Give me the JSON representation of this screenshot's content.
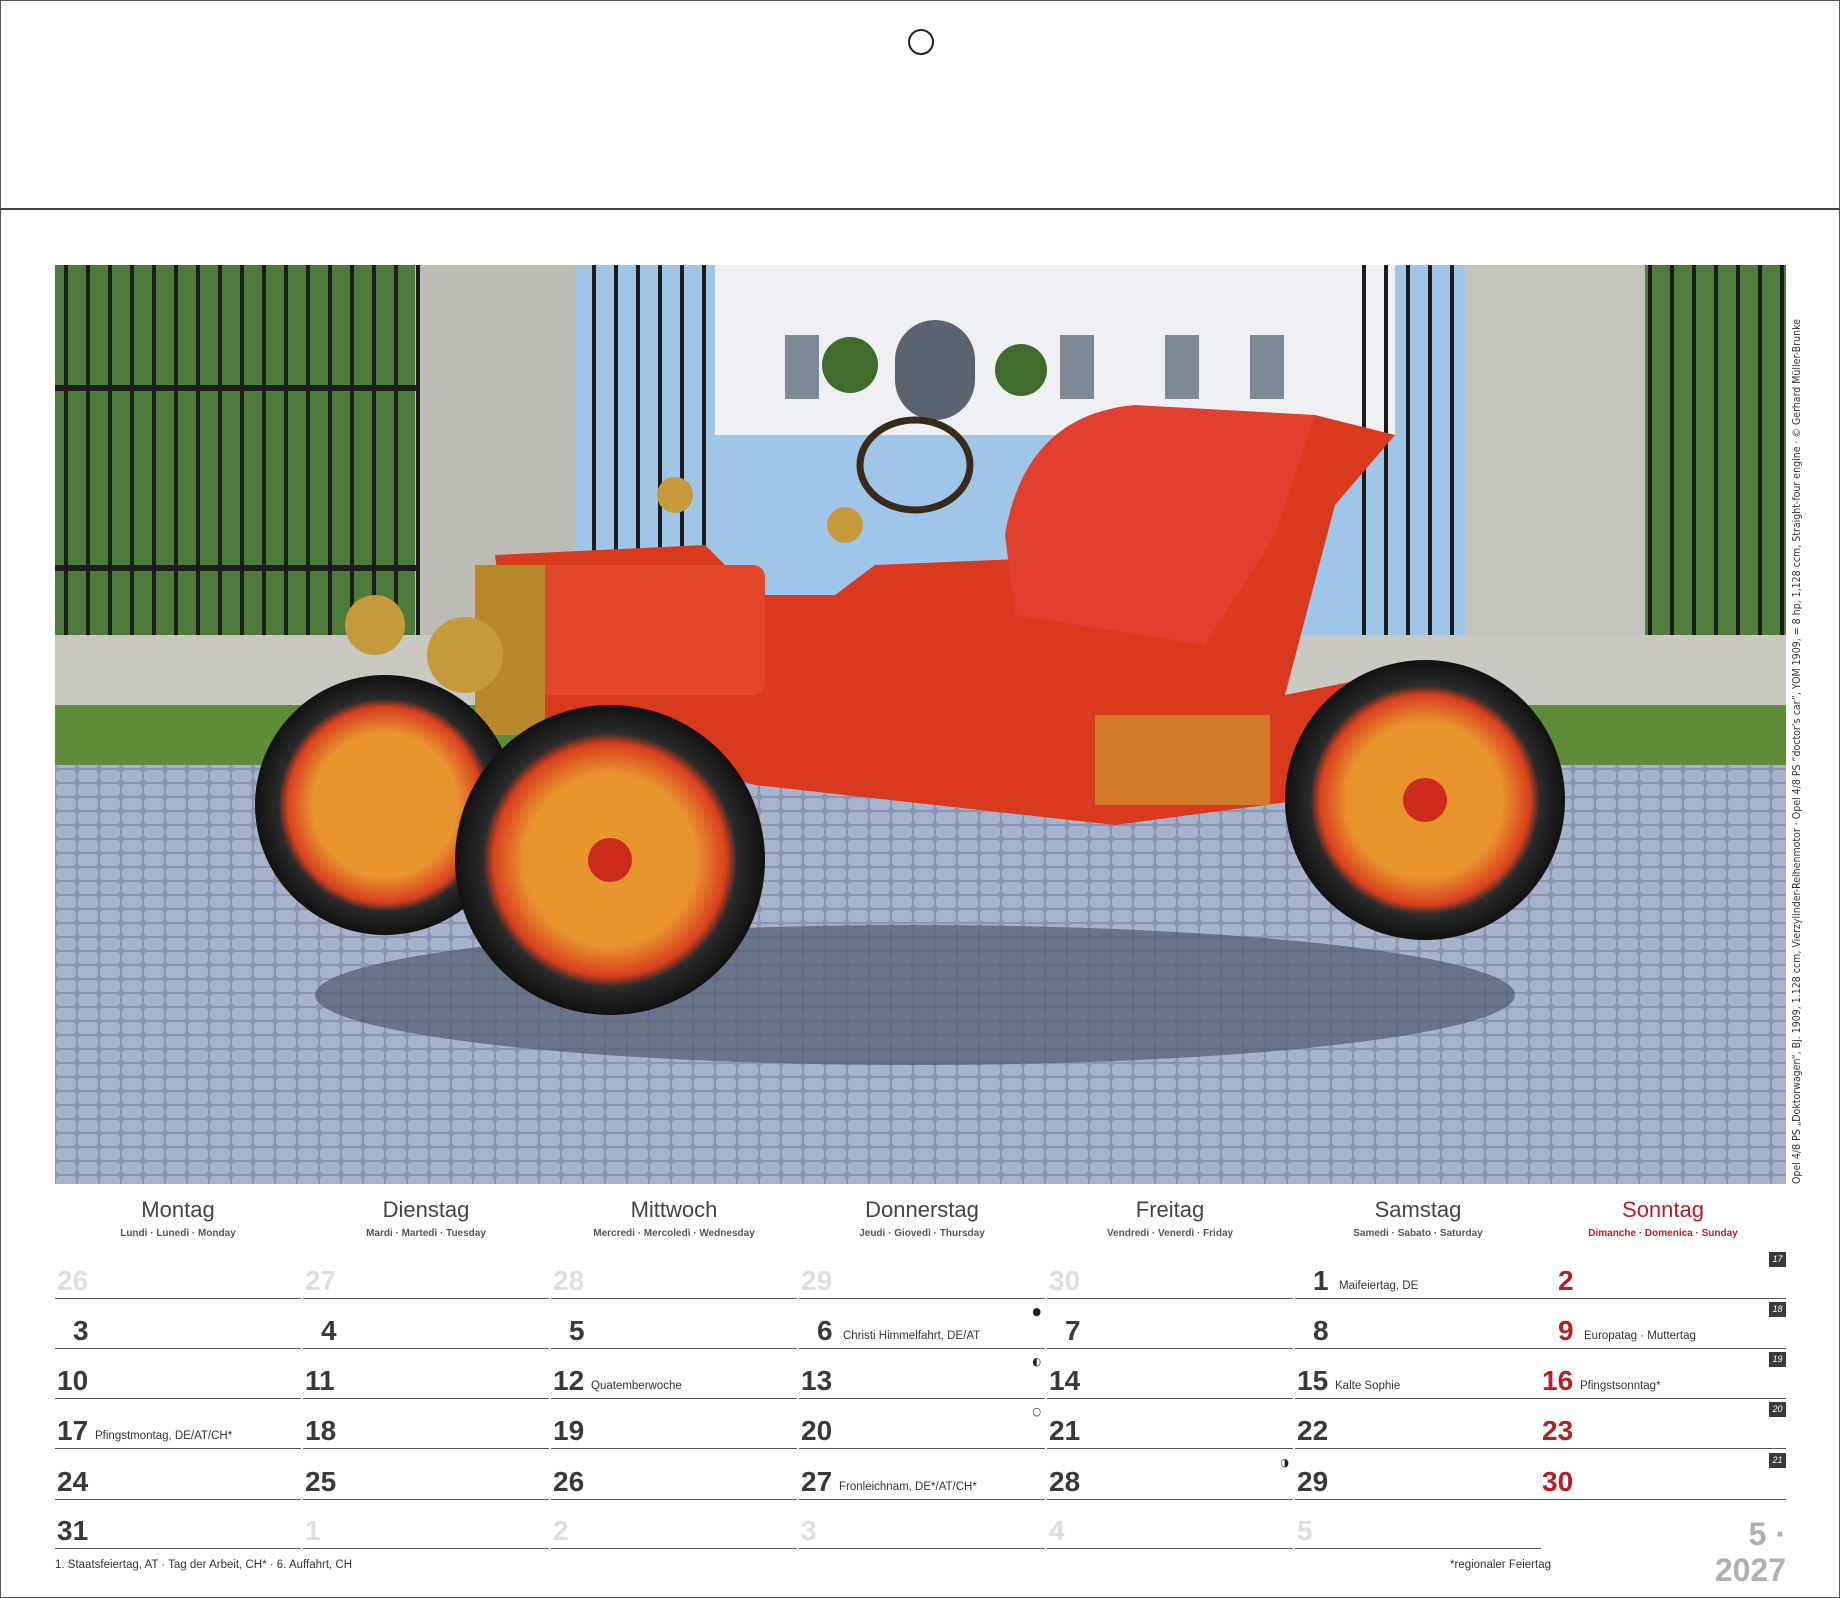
{
  "photo": {
    "caption": "Opel 4/8 PS „Doktorwagen“, Bj. 1909, 1.128 ccm, Vierzylinder-Reihenmotor · Opel 4/8 PS “doctor’s car”, YOM 1909, = 8 hp, 1,128 ccm, Straight-four engine · © Gerhard Müller-Brunke",
    "subject": "red vintage Opel doctor's car in front of wrought-iron gate"
  },
  "weekdays": [
    {
      "name": "Montag",
      "sub": "Lundi · Lunedì · Monday"
    },
    {
      "name": "Dienstag",
      "sub": "Mardi · Martedì · Tuesday"
    },
    {
      "name": "Mittwoch",
      "sub": "Mercredi · Mercoledì · Wednesday"
    },
    {
      "name": "Donnerstag",
      "sub": "Jeudi · Giovedì · Thursday"
    },
    {
      "name": "Freitag",
      "sub": "Vendredi · Venerdì · Friday"
    },
    {
      "name": "Samstag",
      "sub": "Samedi · Sabato · Saturday"
    },
    {
      "name": "Sonntag",
      "sub": "Dimanche · Domenica · Sunday"
    }
  ],
  "weeks": [
    {
      "week": "17",
      "days": [
        {
          "num": "26",
          "faded": true
        },
        {
          "num": "27",
          "faded": true
        },
        {
          "num": "28",
          "faded": true
        },
        {
          "num": "29",
          "faded": true
        },
        {
          "num": "30",
          "faded": true
        },
        {
          "num": "1",
          "note": "Maifeiertag, DE"
        },
        {
          "num": "2"
        }
      ]
    },
    {
      "week": "18",
      "days": [
        {
          "num": "3"
        },
        {
          "num": "4"
        },
        {
          "num": "5"
        },
        {
          "num": "6",
          "note": "Christi Himmelfahrt, DE/AT",
          "moon": "●"
        },
        {
          "num": "7"
        },
        {
          "num": "8"
        },
        {
          "num": "9",
          "note": "Europatag · Muttertag"
        }
      ]
    },
    {
      "week": "19",
      "days": [
        {
          "num": "10"
        },
        {
          "num": "11"
        },
        {
          "num": "12",
          "note": "Quatemberwoche"
        },
        {
          "num": "13",
          "moon": "◐"
        },
        {
          "num": "14"
        },
        {
          "num": "15",
          "note": "Kalte Sophie"
        },
        {
          "num": "16",
          "note": "Pfingstsonntag*"
        }
      ]
    },
    {
      "week": "20",
      "days": [
        {
          "num": "17",
          "note": "Pfingstmontag, DE/AT/CH*"
        },
        {
          "num": "18"
        },
        {
          "num": "19"
        },
        {
          "num": "20",
          "moon": "○"
        },
        {
          "num": "21"
        },
        {
          "num": "22"
        },
        {
          "num": "23"
        }
      ]
    },
    {
      "week": "21",
      "days": [
        {
          "num": "24"
        },
        {
          "num": "25"
        },
        {
          "num": "26"
        },
        {
          "num": "27",
          "note": "Fronleichnam, DE*/AT/CH*"
        },
        {
          "num": "28",
          "moon": "◑"
        },
        {
          "num": "29"
        },
        {
          "num": "30"
        }
      ]
    },
    {
      "week": "",
      "days": [
        {
          "num": "31"
        },
        {
          "num": "1",
          "faded": true
        },
        {
          "num": "2",
          "faded": true
        },
        {
          "num": "3",
          "faded": true
        },
        {
          "num": "4",
          "faded": true
        },
        {
          "num": "5",
          "faded": true
        }
      ]
    }
  ],
  "month_label": "5 · 2027",
  "footnote_left": "1. Staatsfeiertag, AT  ·  Tag der Arbeit, CH*  ·  6. Auffahrt, CH",
  "footnote_right": "*regionaler Feiertag",
  "colors": {
    "sunday": "#b3202a",
    "text": "#3a3a3a",
    "faded": "#dedede",
    "car_body": "#d93a1e",
    "wheels": "#e8902e"
  }
}
